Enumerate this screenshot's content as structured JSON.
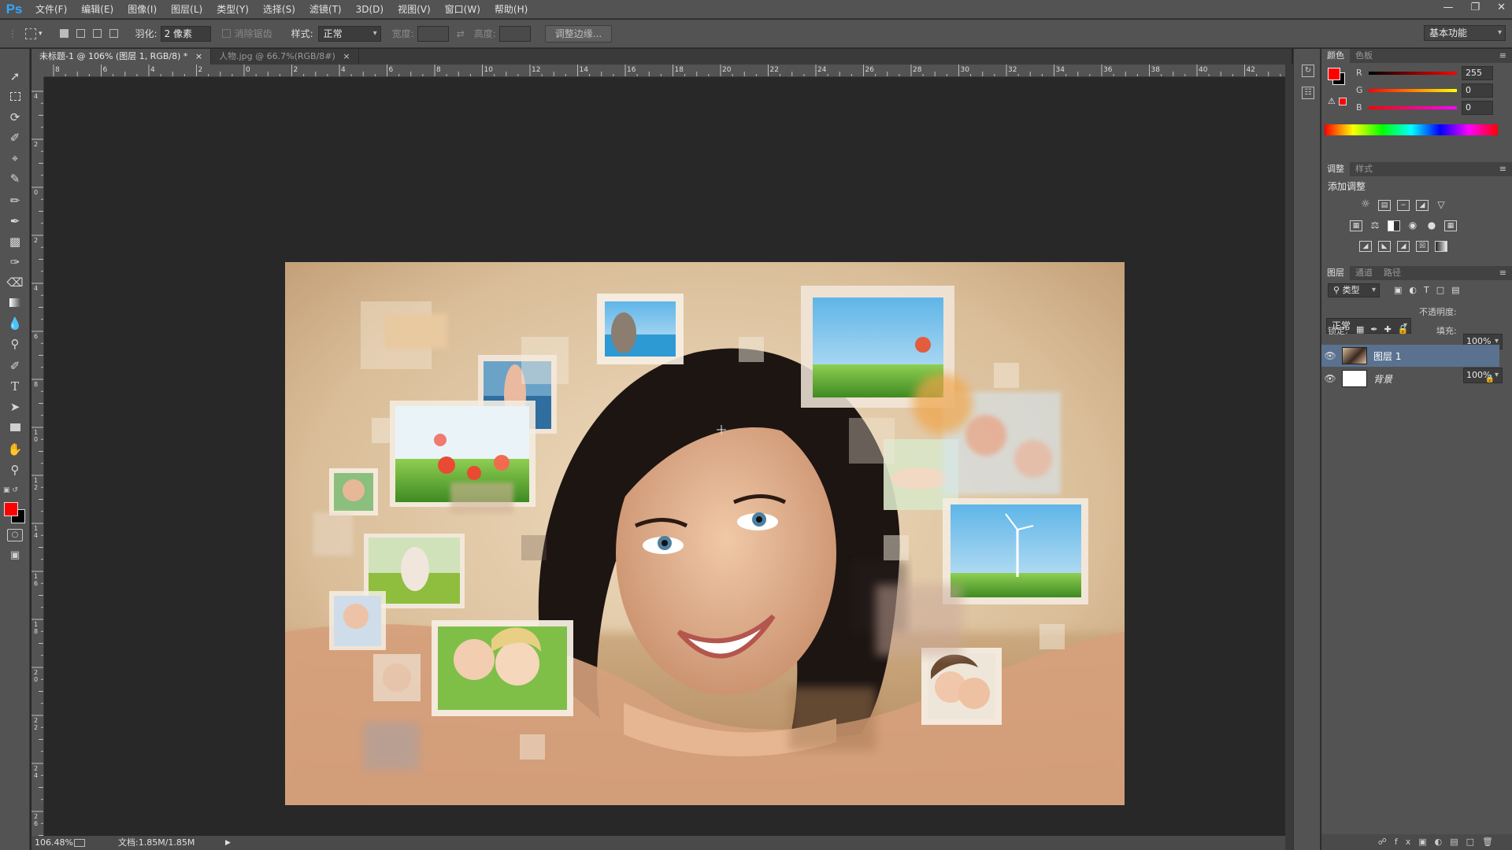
{
  "app": {
    "logo": "Ps"
  },
  "menu": [
    "文件(F)",
    "编辑(E)",
    "图像(I)",
    "图层(L)",
    "类型(Y)",
    "选择(S)",
    "滤镜(T)",
    "3D(D)",
    "视图(V)",
    "窗口(W)",
    "帮助(H)"
  ],
  "options": {
    "feather_label": "羽化:",
    "feather_value": "2 像素",
    "antialias_label": "消除锯齿",
    "style_label": "样式:",
    "style_value": "正常",
    "width_label": "宽度:",
    "height_label": "高度:",
    "refine_edge": "调整边缘...",
    "workspace": "基本功能"
  },
  "tabs": [
    {
      "label": "未标题-1 @ 106% (图层 1, RGB/8) *",
      "active": true
    },
    {
      "label": "人物.jpg @ 66.7%(RGB/8#)",
      "active": false
    }
  ],
  "ruler": {
    "h_labels": [
      "8",
      "6",
      "4",
      "2",
      "0",
      "2",
      "4",
      "6",
      "8",
      "10",
      "12",
      "14",
      "16",
      "18",
      "20",
      "22",
      "24",
      "26",
      "28",
      "30",
      "32",
      "34",
      "36",
      "38",
      "40",
      "42"
    ],
    "v_labels": [
      "4",
      "2",
      "0",
      "2",
      "4",
      "6",
      "8",
      "1 0",
      "1 2",
      "1 4",
      "1 6",
      "1 8",
      "2 0",
      "2 2",
      "2 4",
      "2 6"
    ]
  },
  "status": {
    "zoom": "106.48%",
    "doc": "文档:1.85M/1.85M"
  },
  "color_panel": {
    "tabs": [
      "颜色",
      "色板"
    ],
    "channels": [
      {
        "label": "R",
        "value": "255"
      },
      {
        "label": "G",
        "value": "0"
      },
      {
        "label": "B",
        "value": "0"
      }
    ],
    "foreground": "#ff0000",
    "background": "#000000"
  },
  "adjust_panel": {
    "tabs": [
      "调整",
      "样式"
    ],
    "title": "添加调整"
  },
  "layers_panel": {
    "tabs": [
      "图层",
      "通道",
      "路径"
    ],
    "kind": "类型",
    "blend": "正常",
    "opacity_label": "不透明度:",
    "opacity": "100%",
    "lock_label": "锁定:",
    "fill_label": "填充:",
    "fill": "100%",
    "layers": [
      {
        "name": "图层 1",
        "selected": true
      },
      {
        "name": "背景",
        "selected": false
      }
    ]
  },
  "tools": [
    "move-tool",
    "marquee-tool",
    "lasso-tool",
    "quick-select-tool",
    "crop-tool",
    "eyedropper-tool",
    "healing-brush-tool",
    "brush-tool",
    "clone-stamp-tool",
    "history-brush-tool",
    "eraser-tool",
    "gradient-tool",
    "blur-tool",
    "dodge-tool",
    "pen-tool",
    "type-tool",
    "path-select-tool",
    "rectangle-tool",
    "hand-tool",
    "zoom-tool"
  ],
  "colors": {
    "chrome": "#535353",
    "dark": "#282828",
    "selected_layer": "#5a7290",
    "ps_blue": "#31a8ff"
  }
}
